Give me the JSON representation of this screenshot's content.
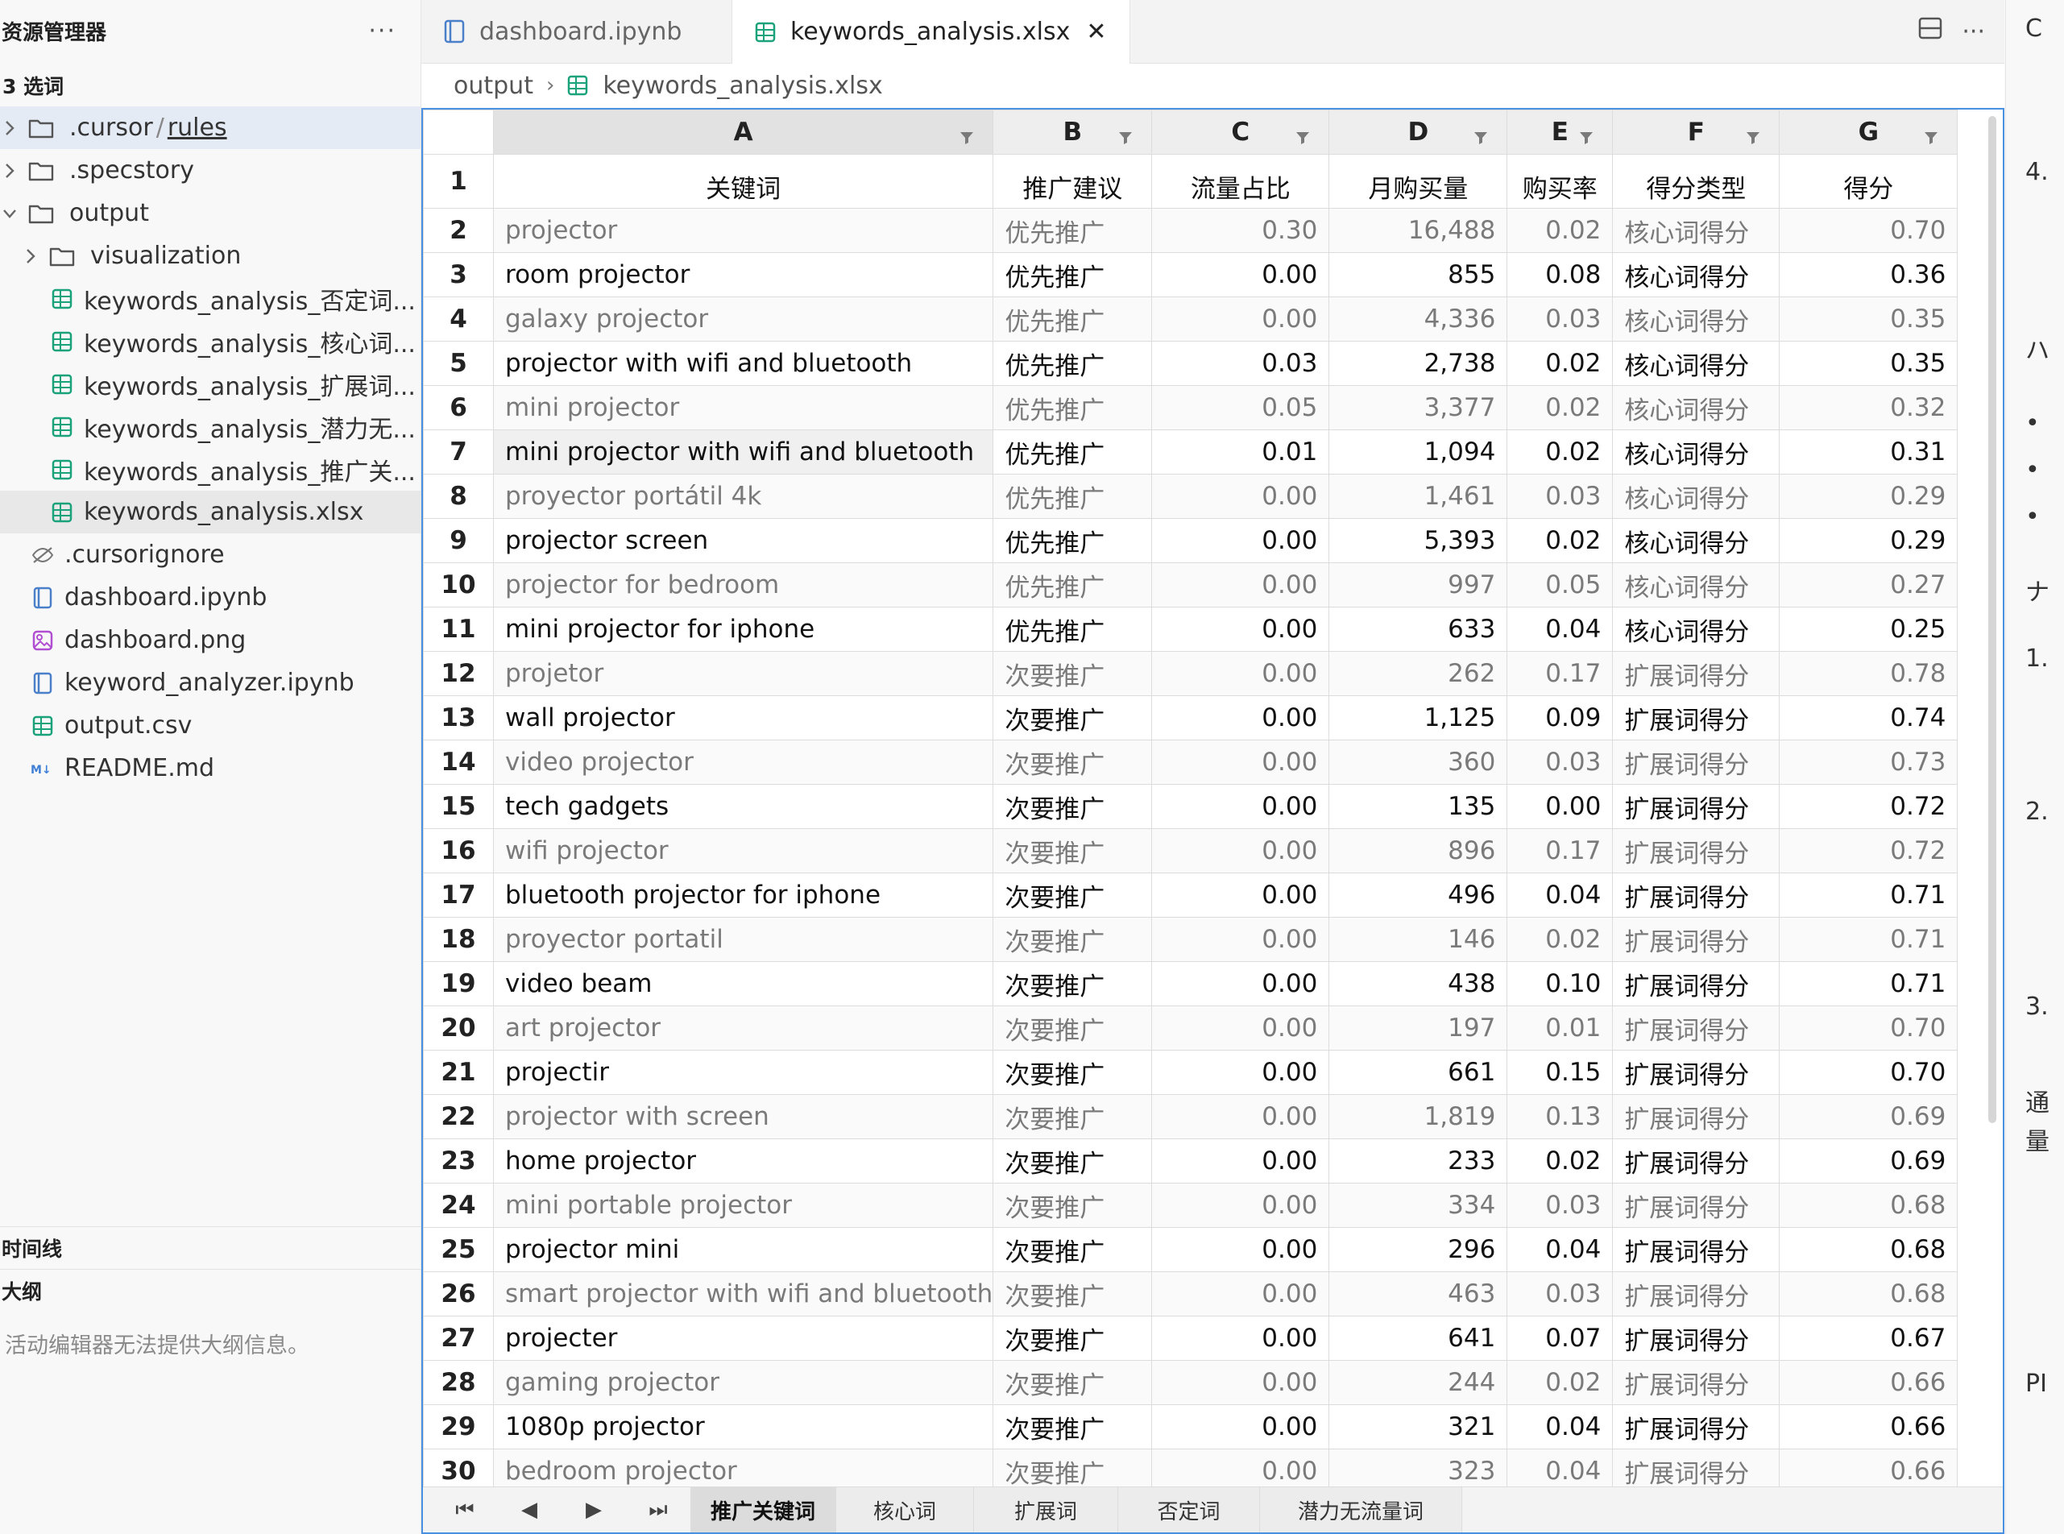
{
  "sidebar": {
    "title": "资源管理器",
    "more": "···",
    "section": "3 选词",
    "items": [
      {
        "label_a": ".cursor",
        "sep": "/",
        "label_b": "rules",
        "depth": 0,
        "type": "folder",
        "expanded": false
      },
      {
        "label": ".specstory",
        "depth": 0,
        "type": "folder",
        "expanded": false
      },
      {
        "label": "output",
        "depth": 0,
        "type": "folder",
        "expanded": true
      },
      {
        "label": "visualization",
        "depth": 1,
        "type": "folder",
        "expanded": false
      },
      {
        "label": "keywords_analysis_否定词...",
        "depth": 1,
        "type": "sheet"
      },
      {
        "label": "keywords_analysis_核心词...",
        "depth": 1,
        "type": "sheet"
      },
      {
        "label": "keywords_analysis_扩展词...",
        "depth": 1,
        "type": "sheet"
      },
      {
        "label": "keywords_analysis_潜力无...",
        "depth": 1,
        "type": "sheet"
      },
      {
        "label": "keywords_analysis_推广关...",
        "depth": 1,
        "type": "sheet"
      },
      {
        "label": "keywords_analysis.xlsx",
        "depth": 1,
        "type": "sheet"
      },
      {
        "label": ".cursorignore",
        "depth": 0,
        "type": "ignore"
      },
      {
        "label": "dashboard.ipynb",
        "depth": 0,
        "type": "notebook"
      },
      {
        "label": "dashboard.png",
        "depth": 0,
        "type": "image"
      },
      {
        "label": "keyword_analyzer.ipynb",
        "depth": 0,
        "type": "notebook"
      },
      {
        "label": "output.csv",
        "depth": 0,
        "type": "sheet"
      },
      {
        "label": "README.md",
        "depth": 0,
        "type": "markdown"
      }
    ],
    "timeline": "时间线",
    "outline": "大纲",
    "outline_empty": "活动编辑器无法提供大纲信息。"
  },
  "tabs": [
    {
      "label": "dashboard.ipynb",
      "active": false
    },
    {
      "label": "keywords_analysis.xlsx",
      "active": true,
      "close": "✕"
    }
  ],
  "tab_actions": {
    "more": "···"
  },
  "breadcrumb": {
    "folder": "output",
    "file": "keywords_analysis.xlsx"
  },
  "sheet": {
    "columns": [
      "A",
      "B",
      "C",
      "D",
      "E",
      "F",
      "G"
    ],
    "header_row": [
      "关键词",
      "推广建议",
      "流量占比",
      "月购买量",
      "购买率",
      "得分类型",
      "得分"
    ],
    "rows": [
      [
        "2",
        "projector",
        "优先推广",
        "0.30",
        "16,488",
        "0.02",
        "核心词得分",
        "0.70"
      ],
      [
        "3",
        "room projector",
        "优先推广",
        "0.00",
        "855",
        "0.08",
        "核心词得分",
        "0.36"
      ],
      [
        "4",
        "galaxy projector",
        "优先推广",
        "0.00",
        "4,336",
        "0.03",
        "核心词得分",
        "0.35"
      ],
      [
        "5",
        "projector with wifi and bluetooth",
        "优先推广",
        "0.03",
        "2,738",
        "0.02",
        "核心词得分",
        "0.35"
      ],
      [
        "6",
        "mini projector",
        "优先推广",
        "0.05",
        "3,377",
        "0.02",
        "核心词得分",
        "0.32"
      ],
      [
        "7",
        "mini projector with wifi and bluetooth",
        "优先推广",
        "0.01",
        "1,094",
        "0.02",
        "核心词得分",
        "0.31"
      ],
      [
        "8",
        "proyector portátil 4k",
        "优先推广",
        "0.00",
        "1,461",
        "0.03",
        "核心词得分",
        "0.29"
      ],
      [
        "9",
        "projector screen",
        "优先推广",
        "0.00",
        "5,393",
        "0.02",
        "核心词得分",
        "0.29"
      ],
      [
        "10",
        "projector for bedroom",
        "优先推广",
        "0.00",
        "997",
        "0.05",
        "核心词得分",
        "0.27"
      ],
      [
        "11",
        "mini projector for iphone",
        "优先推广",
        "0.00",
        "633",
        "0.04",
        "核心词得分",
        "0.25"
      ],
      [
        "12",
        "projetor",
        "次要推广",
        "0.00",
        "262",
        "0.17",
        "扩展词得分",
        "0.78"
      ],
      [
        "13",
        "wall projector",
        "次要推广",
        "0.00",
        "1,125",
        "0.09",
        "扩展词得分",
        "0.74"
      ],
      [
        "14",
        "video projector",
        "次要推广",
        "0.00",
        "360",
        "0.03",
        "扩展词得分",
        "0.73"
      ],
      [
        "15",
        "tech gadgets",
        "次要推广",
        "0.00",
        "135",
        "0.00",
        "扩展词得分",
        "0.72"
      ],
      [
        "16",
        "wifi projector",
        "次要推广",
        "0.00",
        "896",
        "0.17",
        "扩展词得分",
        "0.72"
      ],
      [
        "17",
        "bluetooth projector for iphone",
        "次要推广",
        "0.00",
        "496",
        "0.04",
        "扩展词得分",
        "0.71"
      ],
      [
        "18",
        "proyector portatil",
        "次要推广",
        "0.00",
        "146",
        "0.02",
        "扩展词得分",
        "0.71"
      ],
      [
        "19",
        "video beam",
        "次要推广",
        "0.00",
        "438",
        "0.10",
        "扩展词得分",
        "0.71"
      ],
      [
        "20",
        "art projector",
        "次要推广",
        "0.00",
        "197",
        "0.01",
        "扩展词得分",
        "0.70"
      ],
      [
        "21",
        "projectir",
        "次要推广",
        "0.00",
        "661",
        "0.15",
        "扩展词得分",
        "0.70"
      ],
      [
        "22",
        "projector with screen",
        "次要推广",
        "0.00",
        "1,819",
        "0.13",
        "扩展词得分",
        "0.69"
      ],
      [
        "23",
        "home projector",
        "次要推广",
        "0.00",
        "233",
        "0.02",
        "扩展词得分",
        "0.69"
      ],
      [
        "24",
        "mini portable projector",
        "次要推广",
        "0.00",
        "334",
        "0.03",
        "扩展词得分",
        "0.68"
      ],
      [
        "25",
        "projector mini",
        "次要推广",
        "0.00",
        "296",
        "0.04",
        "扩展词得分",
        "0.68"
      ],
      [
        "26",
        "smart projector with wifi and bluetooth",
        "次要推广",
        "0.00",
        "463",
        "0.03",
        "扩展词得分",
        "0.68"
      ],
      [
        "27",
        "projecter",
        "次要推广",
        "0.00",
        "641",
        "0.07",
        "扩展词得分",
        "0.67"
      ],
      [
        "28",
        "gaming projector",
        "次要推广",
        "0.00",
        "244",
        "0.02",
        "扩展词得分",
        "0.66"
      ],
      [
        "29",
        "1080p projector",
        "次要推广",
        "0.00",
        "321",
        "0.04",
        "扩展词得分",
        "0.66"
      ],
      [
        "30",
        "bedroom projector",
        "次要推广",
        "0.00",
        "323",
        "0.04",
        "扩展词得分",
        "0.66"
      ]
    ],
    "sheet_tabs": [
      "推广关键词",
      "核心词",
      "扩展词",
      "否定词",
      "潜力无流量词"
    ],
    "active_sheet": "推广关键词"
  },
  "right_panel": {
    "lines": [
      "C",
      "4.",
      "ハ",
      "•",
      "•",
      "•",
      "ナ",
      "1.",
      "2.",
      "3.",
      "通",
      "量",
      "PI"
    ]
  },
  "colors": {
    "accent": "#4a90e2",
    "sheet_icon": "#1aa27a",
    "notebook_icon": "#4a7fc9",
    "image_icon": "#b04fd1",
    "markdown_icon": "#3f7fd6"
  }
}
